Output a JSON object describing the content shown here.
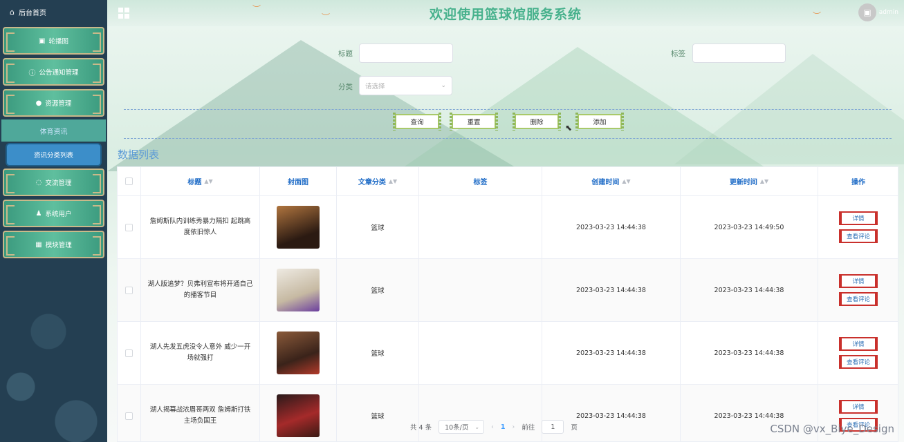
{
  "sidebar": {
    "home_label": "后台首页",
    "items": [
      {
        "label": "轮播图"
      },
      {
        "label": "公告通知管理"
      },
      {
        "label": "资源管理"
      },
      {
        "label": "体育资讯"
      },
      {
        "label": "资讯分类列表"
      },
      {
        "label": "交流管理"
      },
      {
        "label": "系统用户"
      },
      {
        "label": "模块管理"
      }
    ]
  },
  "header": {
    "title": "欢迎使用篮球馆服务系统",
    "user": "admin"
  },
  "search": {
    "title_label": "标题",
    "tag_label": "标签",
    "category_label": "分类",
    "category_placeholder": "请选择",
    "buttons": {
      "query": "查询",
      "reset": "重置",
      "delete": "删除",
      "add": "添加"
    }
  },
  "list": {
    "title": "数据列表",
    "columns": {
      "title": "标题",
      "cover": "封面图",
      "category": "文章分类",
      "tag": "标签",
      "created": "创建时间",
      "updated": "更新时间",
      "actions": "操作"
    },
    "action_detail": "详情",
    "action_comments": "查看评论",
    "rows": [
      {
        "title": "詹姆斯队内训练秀暴力隔扣 起跳高度依旧惊人",
        "category": "篮球",
        "tag": "",
        "created": "2023-03-23 14:44:38",
        "updated": "2023-03-23 14:49:50",
        "cover_color": "#7a4a2a"
      },
      {
        "title": "湖人版追梦？贝弗利宣布将开通自己的播客节目",
        "category": "篮球",
        "tag": "",
        "created": "2023-03-23 14:44:38",
        "updated": "2023-03-23 14:44:38",
        "cover_color": "#d9d2c4"
      },
      {
        "title": "湖人先发五虎没令人意外 威少一开场就强打",
        "category": "篮球",
        "tag": "",
        "created": "2023-03-23 14:44:38",
        "updated": "2023-03-23 14:44:38",
        "cover_color": "#5b3a2b"
      },
      {
        "title": "湖人揭幕战浓眉哥两双 詹姆斯打铁主场负国王",
        "category": "篮球",
        "tag": "",
        "created": "2023-03-23 14:44:38",
        "updated": "2023-03-23 14:44:38",
        "cover_color": "#6a2222"
      }
    ]
  },
  "pagination": {
    "total": "共 4 条",
    "page_size": "10条/页",
    "prev": "‹",
    "current": "1",
    "next": "›",
    "goto_label": "前往",
    "goto_value": "1",
    "page_unit": "页"
  },
  "watermark": "CSDN @vx_Biye_Design"
}
